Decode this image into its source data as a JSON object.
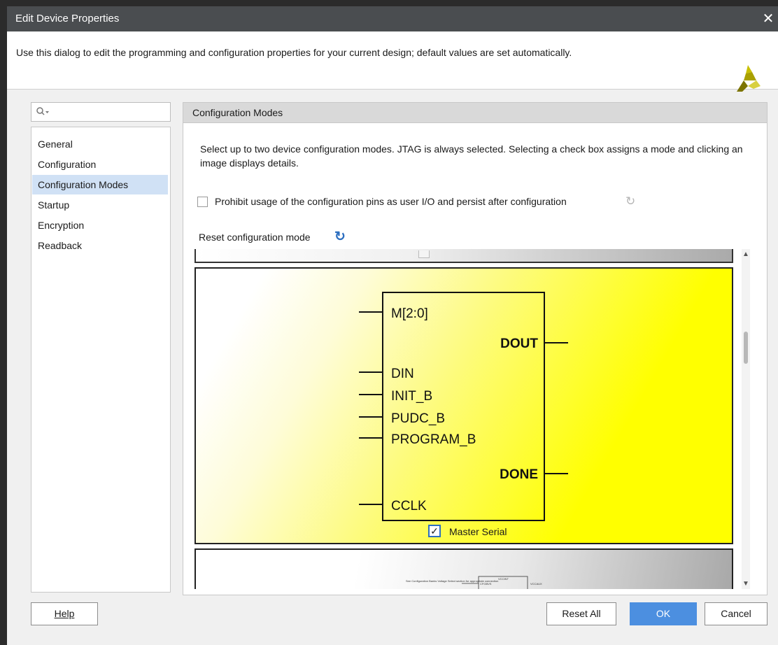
{
  "window": {
    "title": "Edit Device Properties",
    "close_glyph": "✕"
  },
  "banner": {
    "description": "Use this dialog to edit the programming and configuration properties for your current design; default values are set automatically."
  },
  "search": {
    "placeholder": ""
  },
  "sidebar": {
    "items": [
      {
        "label": "General"
      },
      {
        "label": "Configuration"
      },
      {
        "label": "Configuration Modes"
      },
      {
        "label": "Startup"
      },
      {
        "label": "Encryption"
      },
      {
        "label": "Readback"
      }
    ],
    "selected_index": 2
  },
  "panel": {
    "header": "Configuration Modes",
    "instructions": "Select up to two device configuration modes. JTAG is always selected. Selecting a check box assigns a mode and clicking an image displays details.",
    "prohibit_label": "Prohibit usage of the configuration pins as user I/O and persist after configuration",
    "prohibit_checked": false,
    "reset_label": "Reset configuration mode"
  },
  "diagram": {
    "left_pins": [
      "M[2:0]",
      "DIN",
      "INIT_B",
      "PUDC_B",
      "PROGRAM_B",
      "CCLK"
    ],
    "right_pins": [
      "DOUT",
      "DONE"
    ],
    "mode_label": "Master Serial",
    "mode_checked": true,
    "next_card_caption": "See Configuration Banks Voltage Select section for appropriate connection",
    "next_card_pins": [
      "VCCINT",
      "CFGBVS",
      "VCCAUX"
    ]
  },
  "buttons": {
    "help": "Help",
    "reset_all": "Reset All",
    "ok": "OK",
    "cancel": "Cancel"
  },
  "colors": {
    "titlebar": "#4a4d50",
    "selection": "#d0e1f5",
    "ok_button": "#4c8fe0",
    "diagram_highlight": "#ffff00",
    "accent": "#2d6fc0"
  }
}
